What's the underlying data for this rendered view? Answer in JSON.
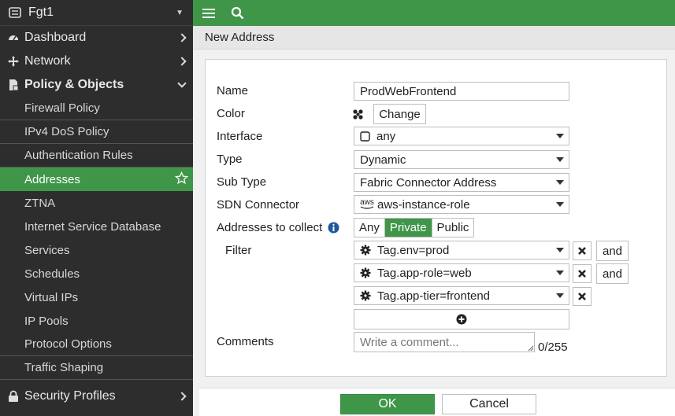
{
  "device": {
    "name": "Fgt1"
  },
  "sidebar": {
    "items": [
      {
        "label": "Dashboard",
        "icon": "dashboard-icon"
      },
      {
        "label": "Network",
        "icon": "network-icon"
      },
      {
        "label": "Policy & Objects",
        "icon": "policy-icon"
      }
    ],
    "subitems": [
      "Firewall Policy",
      "IPv4 DoS Policy",
      "Authentication Rules",
      "Addresses",
      "ZTNA",
      "Internet Service Database",
      "Services",
      "Schedules",
      "Virtual IPs",
      "IP Pools",
      "Protocol Options",
      "Traffic Shaping"
    ],
    "bottom_item": {
      "label": "Security Profiles",
      "icon": "lock-icon"
    }
  },
  "page": {
    "title": "New Address"
  },
  "form": {
    "name_label": "Name",
    "name_value": "ProdWebFrontend",
    "color_label": "Color",
    "color_button": "Change",
    "interface_label": "Interface",
    "interface_value": "any",
    "type_label": "Type",
    "type_value": "Dynamic",
    "subtype_label": "Sub Type",
    "subtype_value": "Fabric Connector Address",
    "sdn_label": "SDN Connector",
    "sdn_badge": "aws",
    "sdn_value": "aws-instance-role",
    "collect_label": "Addresses to collect",
    "collect_options": [
      "Any",
      "Private",
      "Public"
    ],
    "collect_selected": "Private",
    "filter_label": "Filter",
    "filters": [
      "Tag.env=prod",
      "Tag.app-role=web",
      "Tag.app-tier=frontend"
    ],
    "and_label": "and",
    "comments_label": "Comments",
    "comments_placeholder": "Write a comment...",
    "comments_counter": "0/255"
  },
  "footer": {
    "ok": "OK",
    "cancel": "Cancel"
  },
  "colors": {
    "accent": "#3f9649",
    "sidebar_bg": "#2d2d2d"
  }
}
